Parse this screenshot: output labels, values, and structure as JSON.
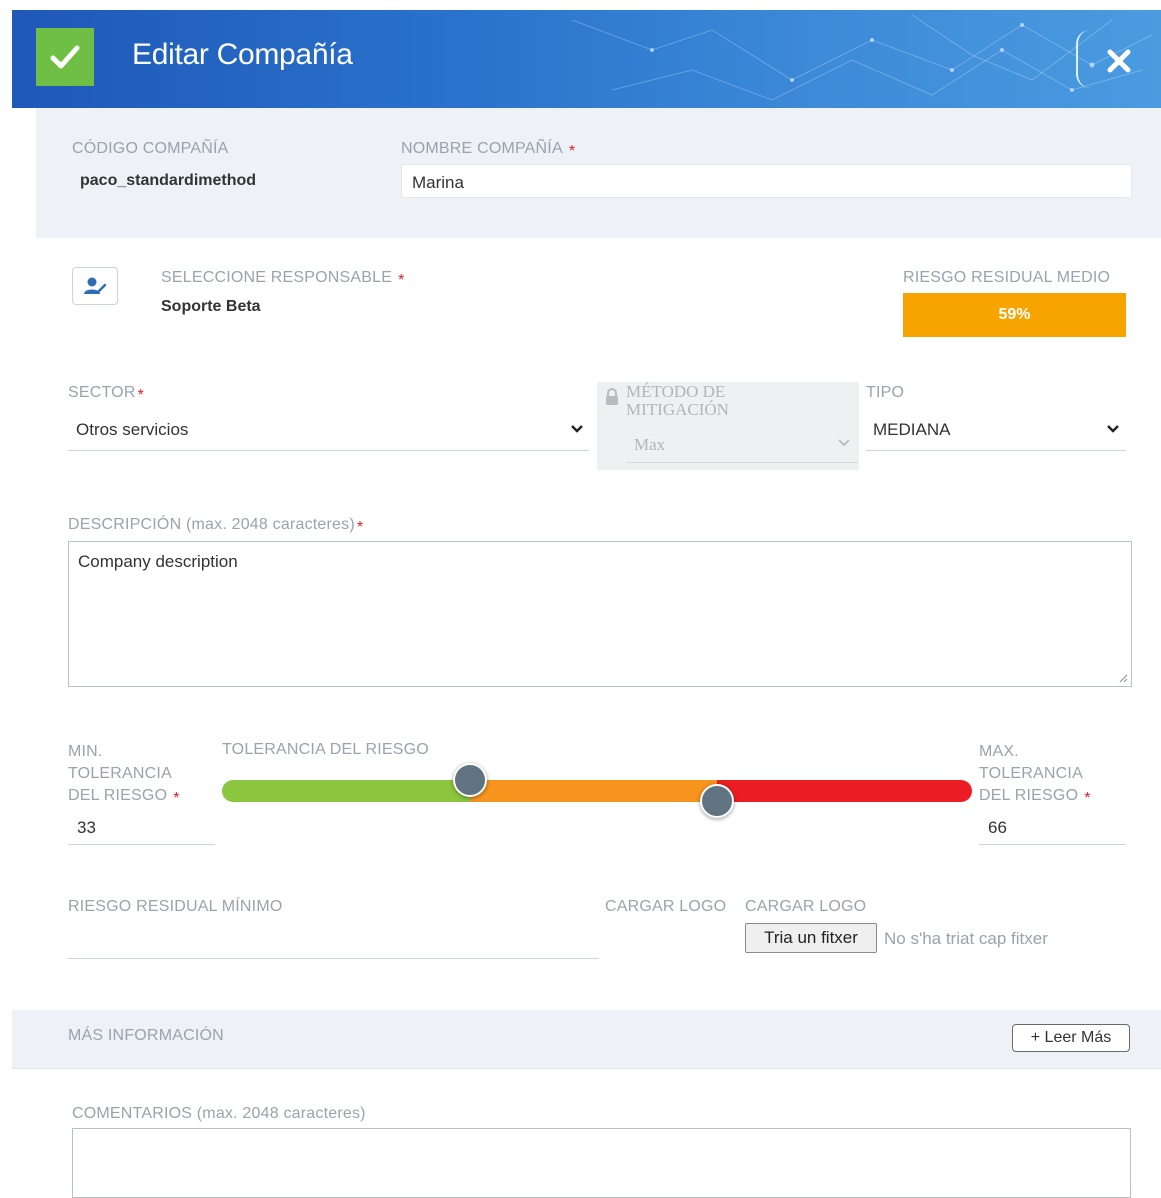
{
  "header": {
    "title": "Editar Compañía",
    "colors": {
      "accent": "#6fbf44",
      "banner": "#2a73cc"
    }
  },
  "company": {
    "code_label": "CÓDIGO COMPAÑÍA",
    "code_value": "paco_standardimethod",
    "name_label": "NOMBRE COMPAÑÍA",
    "name_value": "Marina"
  },
  "responsible": {
    "label": "SELECCIONE RESPONSABLE",
    "value": "Soporte Beta"
  },
  "residual_risk": {
    "label": "RIESGO RESIDUAL MEDIO",
    "value": "59%",
    "color": "#f7a400"
  },
  "sector": {
    "label": "SECTOR",
    "value": "Otros servicios"
  },
  "mitigation": {
    "label_line1": "MÉTODO DE",
    "label_line2": "MITIGACIÓN",
    "value": "Max"
  },
  "tipo": {
    "label": "TIPO",
    "value": "MEDIANA"
  },
  "description": {
    "label": "DESCRIPCIÓN (max. 2048 caracteres)",
    "value": "Company description"
  },
  "tolerance": {
    "min_label_1": "MIN.",
    "min_label_2": "TOLERANCIA",
    "min_label_3": "DEL RIESGO",
    "min_value": "33",
    "title": "TOLERANCIA DEL RIESGO",
    "max_label_1": "MAX.",
    "max_label_2": "TOLERANCIA",
    "max_label_3": "DEL RIESGO",
    "max_value": "66",
    "low_fraction": 0.33,
    "high_fraction": 0.66,
    "colors": {
      "low": "#8cc63f",
      "mid": "#f7941d",
      "high": "#ec1c24"
    }
  },
  "min_residual": {
    "label": "RIESGO RESIDUAL MÍNIMO",
    "value": ""
  },
  "logo": {
    "label_1": "CARGAR LOGO",
    "label_2": "CARGAR LOGO",
    "button": "Tria un fitxer",
    "status": "No s'ha triat cap fitxer"
  },
  "more_info": {
    "label": "MÁS INFORMACIÓN",
    "button": "+ Leer Más"
  },
  "comments": {
    "label": "COMENTARIOS (max. 2048 caracteres)",
    "value": ""
  }
}
